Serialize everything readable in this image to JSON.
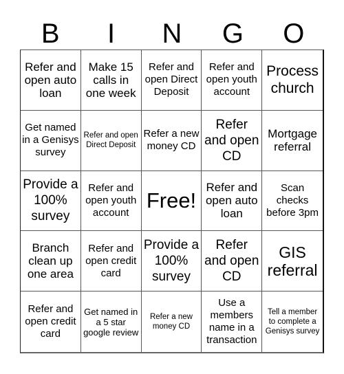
{
  "header": {
    "letters": [
      "B",
      "I",
      "N",
      "G",
      "O"
    ]
  },
  "cells": [
    {
      "text": "Refer and open auto loan",
      "size": "s17"
    },
    {
      "text": "Make 15 calls in one week",
      "size": "s17"
    },
    {
      "text": "Refer and open Direct Deposit",
      "size": "s15"
    },
    {
      "text": "Refer and open youth account",
      "size": "s15"
    },
    {
      "text": "Process church",
      "size": "s21"
    },
    {
      "text": "Get named in a Genisys survey",
      "size": "s15"
    },
    {
      "text": "Refer and open Direct Deposit",
      "size": "s11"
    },
    {
      "text": "Refer a new money CD",
      "size": "s15"
    },
    {
      "text": "Refer and open CD",
      "size": "s19"
    },
    {
      "text": "Mortgage referral",
      "size": "s17"
    },
    {
      "text": "Provide a 100% survey",
      "size": "s19"
    },
    {
      "text": "Refer and open youth account",
      "size": "s15"
    },
    {
      "text": "Free!",
      "size": "s30"
    },
    {
      "text": "Refer and open auto loan",
      "size": "s17"
    },
    {
      "text": "Scan checks before 3pm",
      "size": "s15"
    },
    {
      "text": "Branch clean up one area",
      "size": "s17"
    },
    {
      "text": "Refer and open credit card",
      "size": "s15"
    },
    {
      "text": "Provide a 100% survey",
      "size": "s19"
    },
    {
      "text": "Refer and open CD",
      "size": "s19"
    },
    {
      "text": "GIS referral",
      "size": "s23"
    },
    {
      "text": "Refer and open credit card",
      "size": "s15"
    },
    {
      "text": "Get named in a 5 star google review",
      "size": "s13"
    },
    {
      "text": "Refer a new money CD",
      "size": "s11"
    },
    {
      "text": "Use a members name in a transaction",
      "size": "s15"
    },
    {
      "text": "Tell a member to complete a Genisys survey",
      "size": "s11"
    }
  ]
}
